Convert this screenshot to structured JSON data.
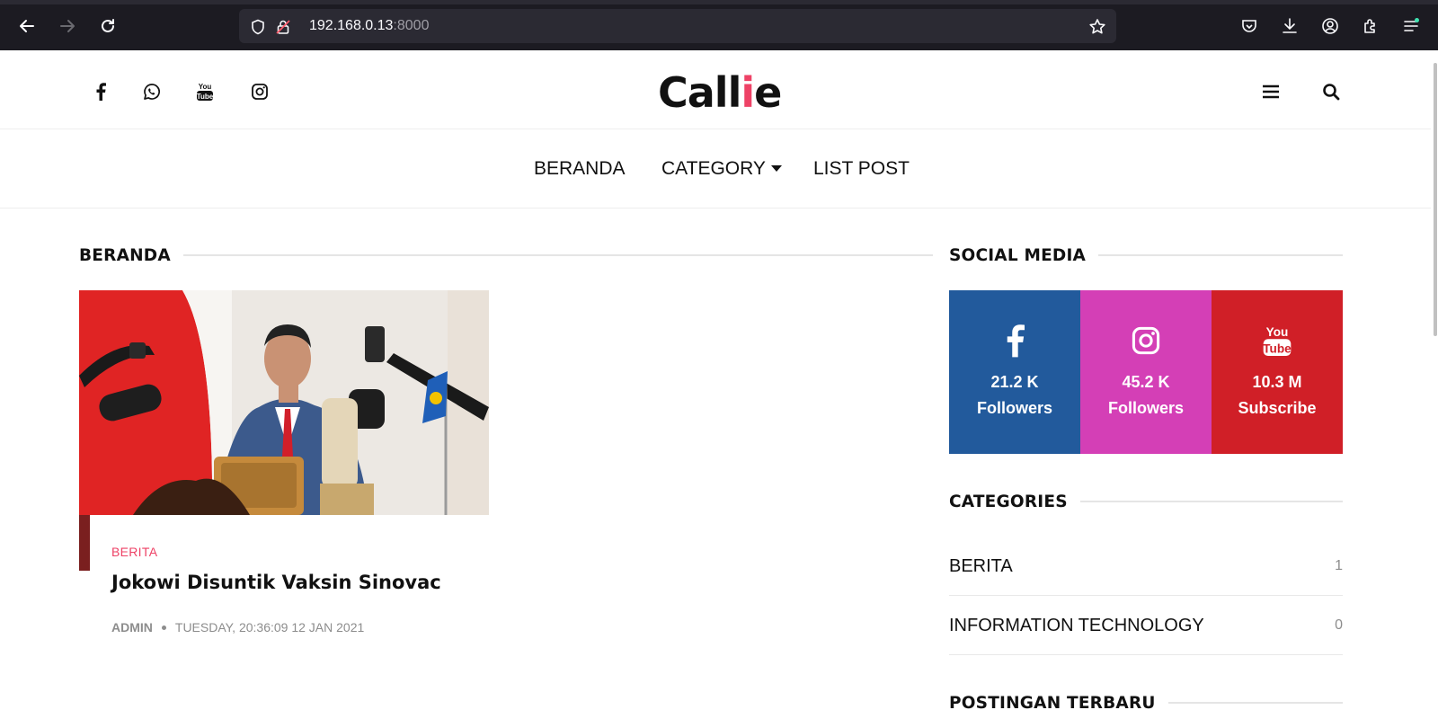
{
  "browser": {
    "url_host": "192.168.0.13",
    "url_port": ":8000"
  },
  "site": {
    "logo_prefix": "Call",
    "logo_accent": "i",
    "logo_suffix": "e",
    "accent_color": "#ee4266"
  },
  "nav": {
    "home": "BERANDA",
    "category": "CATEGORY",
    "list_post": "LIST POST"
  },
  "main": {
    "section_title": "BERANDA",
    "post": {
      "category": "BERITA",
      "title": "Jokowi Disuntik Vaksin Sinovac",
      "author": "ADMIN",
      "date": "TUESDAY, 20:36:09 12 JAN 2021"
    }
  },
  "sidebar": {
    "social_title": "SOCIAL MEDIA",
    "social": [
      {
        "network": "facebook-icon",
        "count": "21.2 K",
        "label": "Followers",
        "color": "#225a9c"
      },
      {
        "network": "instagram-icon",
        "count": "45.2 K",
        "label": "Followers",
        "color": "#d43fb6"
      },
      {
        "network": "youtube-icon",
        "count": "10.3 M",
        "label": "Subscribe",
        "color": "#d01f27"
      }
    ],
    "categories_title": "CATEGORIES",
    "categories": [
      {
        "name": "BERITA",
        "count": "1"
      },
      {
        "name": "INFORMATION TECHNOLOGY",
        "count": "0"
      }
    ],
    "recent_title": "POSTINGAN TERBARU"
  }
}
